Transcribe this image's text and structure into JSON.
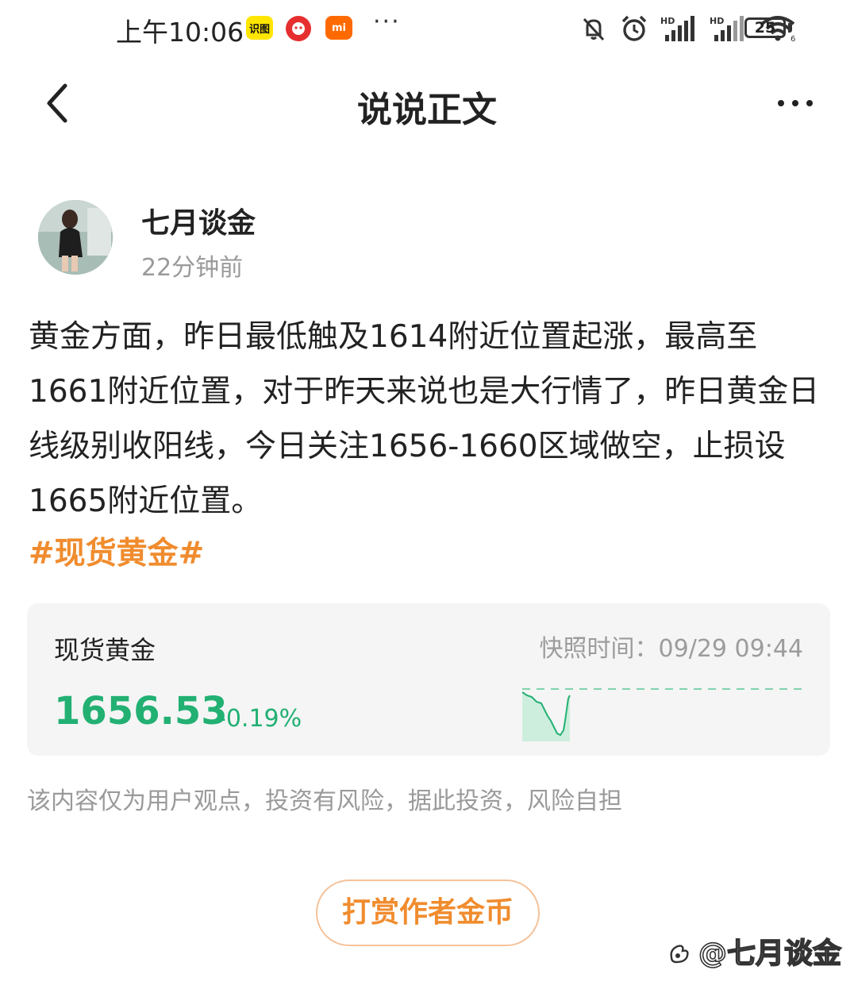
{
  "status_bar": {
    "time": "上午10:06",
    "app_badges": [
      "识图",
      "",
      "mi"
    ],
    "more": "···",
    "battery": "25"
  },
  "nav": {
    "title": "说说正文"
  },
  "author": {
    "name": "七月谈金",
    "time": "22分钟前"
  },
  "post": {
    "text": "黄金方面，昨日最低触及1614附近位置起涨，最高至1661附近位置，对于昨天来说也是大行情了，昨日黄金日线级别收阳线，今日关注1656-1660区域做空，止损设1665附近位置。",
    "hashtag": "#现货黄金#"
  },
  "quote": {
    "name": "现货黄金",
    "snapshot": "快照时间：09/29 09:44",
    "price": "1656.53",
    "change": "-0.19%",
    "colors": {
      "down": "#22b073"
    }
  },
  "disclaimer": "该内容仅为用户观点，投资有风险，据此投资，风险自担",
  "reward_button": "打赏作者金币",
  "watermark": "@七月谈金"
}
